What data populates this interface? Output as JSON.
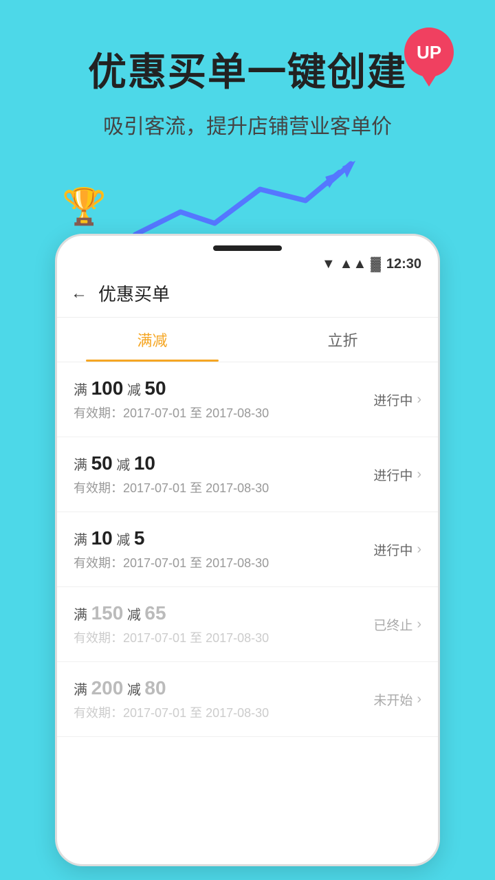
{
  "hero": {
    "title": "优惠买单一键创建",
    "subtitle": "吸引客流，提升店铺营业客单价",
    "up_badge": "UP"
  },
  "status_bar": {
    "time": "12:30",
    "wifi_icon": "wifi",
    "signal_icon": "signal",
    "battery_icon": "battery"
  },
  "app": {
    "back_label": "←",
    "title": "优惠买单",
    "tabs": [
      {
        "id": "manjian",
        "label": "满减",
        "active": true
      },
      {
        "id": "lizhe",
        "label": "立折",
        "active": false
      }
    ]
  },
  "items": [
    {
      "title_prefix": "满",
      "amount1": "100",
      "title_mid": "减",
      "amount2": "50",
      "date": "有效期：2017-07-01 至 2017-08-30",
      "status": "进行中",
      "status_type": "ongoing",
      "greyed": false
    },
    {
      "title_prefix": "满",
      "amount1": "50",
      "title_mid": "减",
      "amount2": "10",
      "date": "有效期：2017-07-01 至 2017-08-30",
      "status": "进行中",
      "status_type": "ongoing",
      "greyed": false
    },
    {
      "title_prefix": "满",
      "amount1": "10",
      "title_mid": "减",
      "amount2": "5",
      "date": "有效期：2017-07-01 至 2017-08-30",
      "status": "进行中",
      "status_type": "ongoing",
      "greyed": false
    },
    {
      "title_prefix": "满",
      "amount1": "150",
      "title_mid": "减",
      "amount2": "65",
      "date": "有效期：2017-07-01 至 2017-08-30",
      "status": "已终止",
      "status_type": "ended",
      "greyed": true
    },
    {
      "title_prefix": "满",
      "amount1": "200",
      "title_mid": "减",
      "amount2": "80",
      "date": "有效期：2017-07-01 至 2017-08-30",
      "status": "未开始",
      "status_type": "notstarted",
      "greyed": true
    }
  ]
}
